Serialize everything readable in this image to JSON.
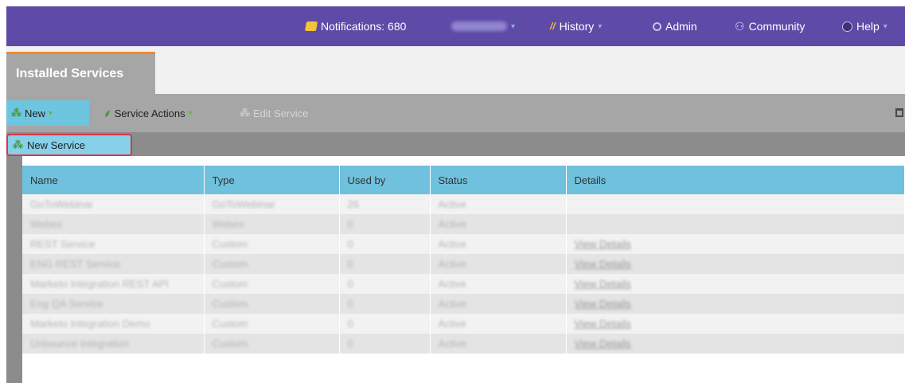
{
  "header": {
    "notifications": "Notifications: 680",
    "user": "",
    "history": "History",
    "admin": "Admin",
    "community": "Community",
    "help": "Help"
  },
  "tabs": [
    {
      "label": "Installed Services"
    }
  ],
  "toolbar": {
    "new_label": "New",
    "service_actions_label": "Service Actions",
    "edit_service_label": "Edit Service"
  },
  "dropdown": {
    "new_service_label": "New Service"
  },
  "table": {
    "columns": [
      "Name",
      "Type",
      "Used by",
      "Status",
      "Details"
    ],
    "rows": [
      [
        "GoToWebinar",
        "GoToWebinar",
        "26",
        "Active",
        ""
      ],
      [
        "Webex",
        "Webex",
        "0",
        "Active",
        ""
      ],
      [
        "REST Service",
        "Custom",
        "0",
        "Active",
        "View Details"
      ],
      [
        "ENG REST Service",
        "Custom",
        "0",
        "Active",
        "View Details"
      ],
      [
        "Marketo Integration REST API",
        "Custom",
        "0",
        "Active",
        "View Details"
      ],
      [
        "Eng QA Service",
        "Custom",
        "0",
        "Active",
        "View Details"
      ],
      [
        "Marketo Integration Demo",
        "Custom",
        "0",
        "Active",
        "View Details"
      ],
      [
        "Unbounce Integration",
        "Custom",
        "0",
        "Active",
        "View Details"
      ]
    ]
  },
  "colors": {
    "topbar": "#5e4aa7",
    "tab_accent": "#ee8a2b",
    "toolbar_active": "#6ec5e0",
    "table_header": "#6fc1dd",
    "highlight_border": "#d2384a"
  }
}
